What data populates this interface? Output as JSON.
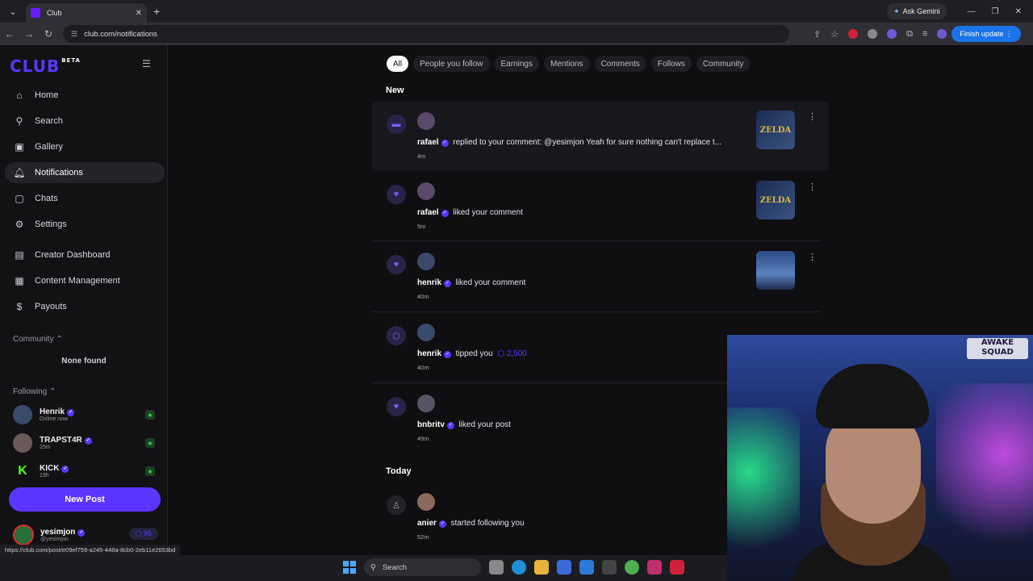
{
  "browser": {
    "tab_title": "Club",
    "url": "club.com/notifications",
    "gemini": "Ask Gemini",
    "finish_update": "Finish update",
    "status_url": "https://club.com/post/e09ef759-a245-448a-8cb0-2eb11e2653bd"
  },
  "sidebar": {
    "logo": "CLUB",
    "logo_tag": "BETA",
    "nav": [
      {
        "label": "Home",
        "icon": "home-icon"
      },
      {
        "label": "Search",
        "icon": "search-icon"
      },
      {
        "label": "Gallery",
        "icon": "gallery-icon"
      },
      {
        "label": "Notifications",
        "icon": "bell-icon"
      },
      {
        "label": "Chats",
        "icon": "chat-icon"
      },
      {
        "label": "Settings",
        "icon": "gear-icon"
      },
      {
        "label": "Creator Dashboard",
        "icon": "dashboard-icon"
      },
      {
        "label": "Content Management",
        "icon": "content-icon"
      },
      {
        "label": "Payouts",
        "icon": "dollar-icon"
      }
    ],
    "community_label": "Community",
    "community_empty": "None found",
    "following_label": "Following",
    "following": [
      {
        "name": "Henrik",
        "sub": "Online now"
      },
      {
        "name": "TRAPST4R",
        "sub": "25m"
      },
      {
        "name": "KICK",
        "sub": "19h"
      }
    ],
    "new_post": "New Post",
    "me": {
      "name": "yesimjon",
      "handle": "@yesimjon",
      "points": "95"
    }
  },
  "filters": [
    "All",
    "People you follow",
    "Earnings",
    "Mentions",
    "Comments",
    "Follows",
    "Community"
  ],
  "groups": {
    "new": "New",
    "today": "Today"
  },
  "notifications": [
    {
      "user": "rafael",
      "text": "replied to your comment: @yesimjon Yeah for sure nothing can't replace t...",
      "time": "4m",
      "type_icon": "comment-icon",
      "thumb": "ZELDA"
    },
    {
      "user": "rafael",
      "text": "liked your comment",
      "time": "5m",
      "type_icon": "heart-icon",
      "thumb": "ZELDA"
    },
    {
      "user": "henrik",
      "text": "liked your comment",
      "time": "40m",
      "type_icon": "heart-icon",
      "thumb": ""
    },
    {
      "user": "henrik",
      "text": "tipped you",
      "amount": "2,500",
      "time": "40m",
      "type_icon": "tip-icon"
    },
    {
      "user": "bnbritv",
      "text": "liked your post",
      "time": "49m",
      "type_icon": "heart-icon"
    },
    {
      "user": "anier",
      "text": "started following you",
      "time": "52m",
      "type_icon": "follow-icon"
    }
  ],
  "webcam": {
    "sign": "AWAKE SQUAD"
  },
  "taskbar": {
    "search": "Search"
  }
}
